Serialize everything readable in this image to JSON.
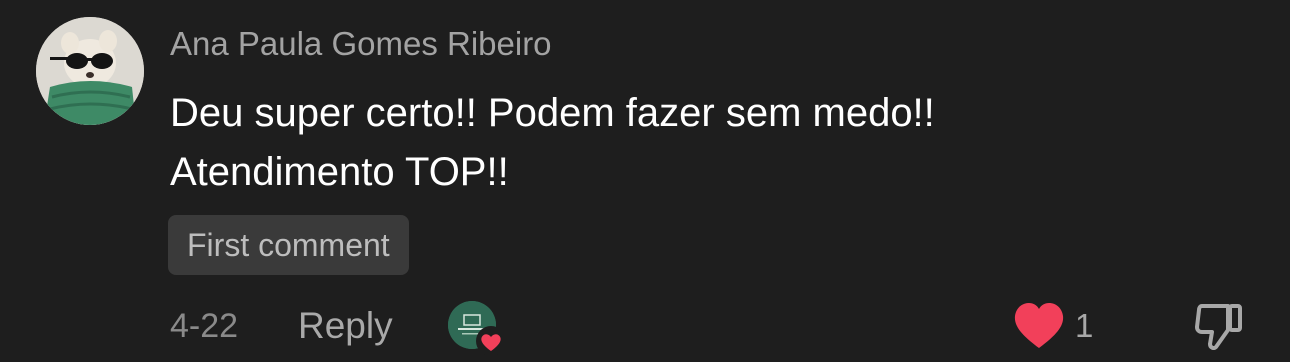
{
  "comment": {
    "author": "Ana Paula Gomes Ribeiro",
    "text_lines": [
      "Deu super certo!! Podem fazer sem medo!!",
      "Atendimento TOP!!"
    ],
    "badge": "First comment",
    "date": "4-22",
    "reply_label": "Reply",
    "like_count": "1"
  },
  "colors": {
    "background": "#1e1e1e",
    "like_heart": "#f2405a",
    "creator_avatar": "#2f6a55"
  },
  "icons": {
    "avatar": "dog-with-sunglasses-and-green-scarf-avatar",
    "creator": "creator-liked-avatar",
    "like": "heart-icon",
    "dislike": "thumbs-down-icon"
  }
}
